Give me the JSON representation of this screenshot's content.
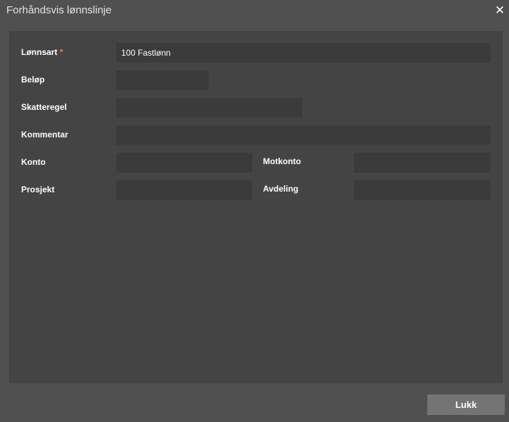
{
  "dialog": {
    "title": "Forhåndsvis lønnslinje",
    "close_icon": "close-icon",
    "close_glyph": "✕"
  },
  "form": {
    "lonnsart": {
      "label": "Lønnsart",
      "required_marker": "*",
      "value": "100 Fastlønn"
    },
    "belop": {
      "label": "Beløp",
      "value": ""
    },
    "skatteregel": {
      "label": "Skatteregel",
      "value": ""
    },
    "kommentar": {
      "label": "Kommentar",
      "value": ""
    },
    "konto": {
      "label": "Konto",
      "value": ""
    },
    "motkonto": {
      "label": "Motkonto",
      "value": ""
    },
    "prosjekt": {
      "label": "Prosjekt",
      "value": ""
    },
    "avdeling": {
      "label": "Avdeling",
      "value": ""
    }
  },
  "footer": {
    "close_label": "Lukk"
  },
  "colors": {
    "dialog_bg": "#505050",
    "content_bg": "#444444",
    "field_bg": "#3b3b3b",
    "button_bg": "#747474",
    "required": "#e08a3c"
  }
}
